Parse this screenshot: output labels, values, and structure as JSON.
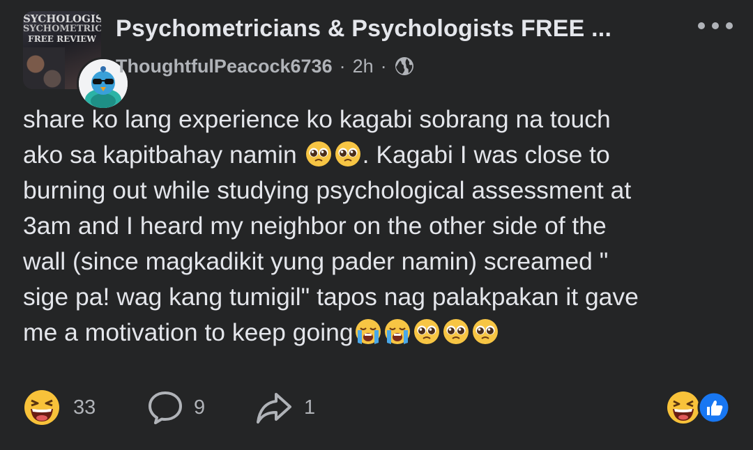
{
  "post": {
    "group_avatar_lines": [
      "SYCHOLOGISTS",
      "SYCHOMETRICIA",
      "FREE REVIEW"
    ],
    "group_name": "Psychometricians &  Psychologists FREE ...",
    "author": "ThoughtfulPeacock6736",
    "meta_separator": "·",
    "time": "2h",
    "audience_icon": "globe-icon",
    "more_icon": "more-options-icon",
    "lines": [
      {
        "text": "share ko lang experience ko kagabi sobrang na touch",
        "emojis": []
      },
      {
        "text": "ako sa kapitbahay namin ",
        "emojis": [
          "pleading-face",
          "pleading-face"
        ],
        "after": ". Kagabi I was close to"
      },
      {
        "text": "burning out while studying psychological assessment at",
        "emojis": []
      },
      {
        "text": "3am and I heard my neighbor on the other side of the",
        "emojis": []
      },
      {
        "text": "wall (since magkadikit yung pader namin) screamed \"",
        "emojis": []
      },
      {
        "text": "sige pa! wag kang tumigil\" tapos nag palakpakan it gave",
        "emojis": []
      },
      {
        "text": "me a motivation to keep going",
        "emojis": [
          "loudly-crying-face",
          "loudly-crying-face",
          "pleading-face",
          "pleading-face",
          "pleading-face"
        ],
        "after": ""
      }
    ]
  },
  "footer": {
    "reaction_count": "33",
    "comment_count": "9",
    "share_count": "1",
    "reaction_icon": "grinning-squinting-face-icon",
    "comment_icon": "comment-icon",
    "share_icon": "share-icon",
    "summary_icons": [
      "haha-reaction-icon",
      "like-reaction-icon"
    ]
  },
  "colors": {
    "background": "#242526",
    "primary_text": "#e4e6eb",
    "secondary_text": "#b0b3b8",
    "like_blue": "#1877f2"
  }
}
